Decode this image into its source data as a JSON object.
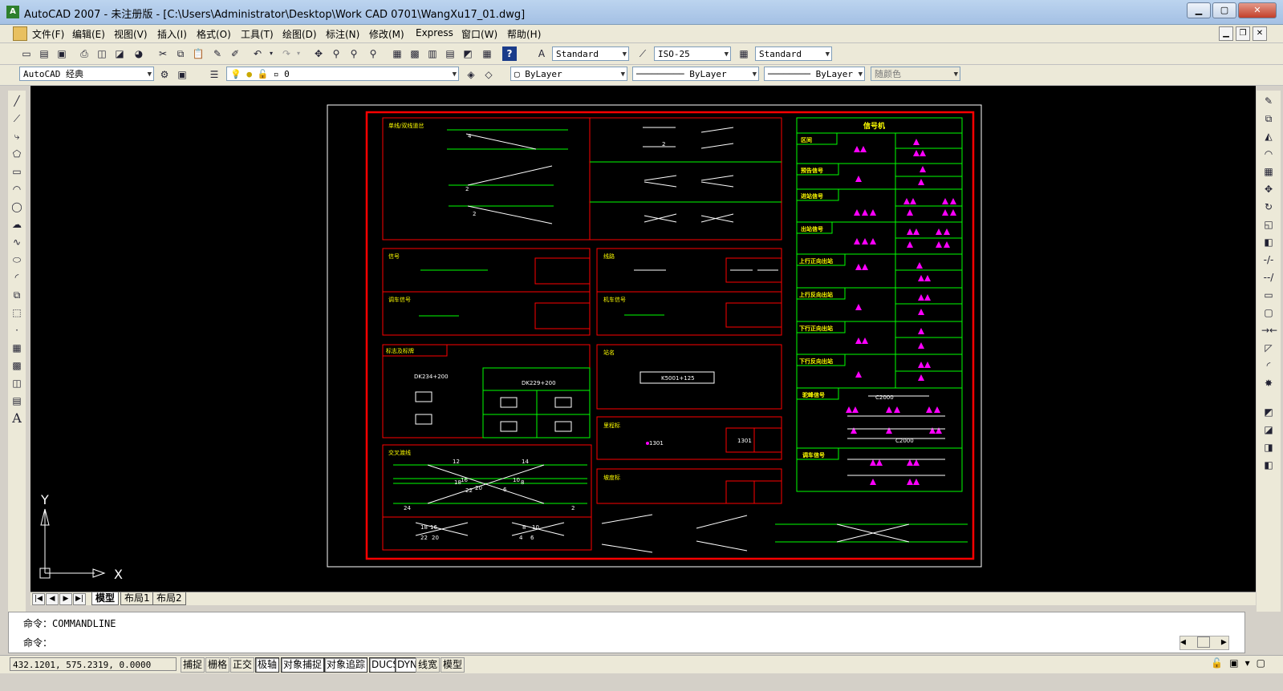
{
  "window": {
    "title": "AutoCAD 2007 - 未注册版 - [C:\\Users\\Administrator\\Desktop\\Work CAD 0701\\WangXu17_01.dwg]",
    "app_icon": "A"
  },
  "menu": [
    "文件(F)",
    "编辑(E)",
    "视图(V)",
    "插入(I)",
    "格式(O)",
    "工具(T)",
    "绘图(D)",
    "标注(N)",
    "修改(M)",
    "Express",
    "窗口(W)",
    "帮助(H)"
  ],
  "toolbar_styles": {
    "text_style": "Standard",
    "dim_style": "ISO-25",
    "table_style": "Standard"
  },
  "toolbar_layers": {
    "workspace": "AutoCAD 经典",
    "layer": "0",
    "color": "ByLayer",
    "linetype": "ByLayer",
    "lineweight": "ByLayer",
    "plot_style": "随颜色"
  },
  "ucs": {
    "x_label": "X",
    "y_label": "Y"
  },
  "drawing": {
    "title_right": "信号机",
    "left_labels": [
      "单线/双线道岔",
      "信号",
      "调车信号",
      "标志及标牌",
      "交叉渡线",
      "线路",
      "机车信号",
      "站名",
      "里程标",
      "坡度标"
    ],
    "right_labels": [
      "区间",
      "预告信号",
      "进站信号",
      "出站信号",
      "上行正向出站",
      "上行反向出站",
      "下行正向出站",
      "下行反向出站",
      "驼峰信号",
      "调车信号"
    ],
    "box_texts": [
      "DK234+200",
      "DK229+200",
      "1301",
      "1301",
      "K5001+125",
      "C2000",
      "C2000"
    ],
    "switch_numbers": [
      "4",
      "2",
      "2",
      "2",
      "12",
      "14",
      "16",
      "18",
      "20",
      "22",
      "24",
      "2",
      "10",
      "8",
      "6",
      "18",
      "16",
      "22",
      "20",
      "8",
      "10",
      "4",
      "6"
    ]
  },
  "tabs": {
    "model": "模型",
    "layout1": "布局1",
    "layout2": "布局2"
  },
  "command": {
    "line1_prompt": "命令：",
    "line1_text": "COMMANDLINE",
    "line2_prompt": "命令："
  },
  "status": {
    "coords": "432.1201, 575.2319, 0.0000",
    "buttons": [
      "捕捉",
      "栅格",
      "正交",
      "极轴",
      "对象捕捉",
      "对象追踪",
      "DUCS",
      "DYN",
      "线宽",
      "模型"
    ]
  }
}
